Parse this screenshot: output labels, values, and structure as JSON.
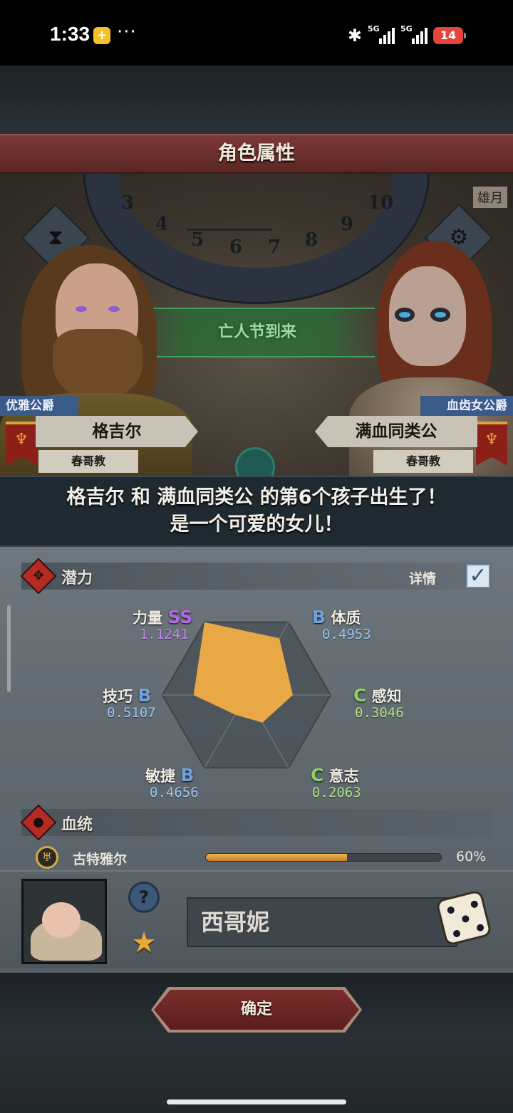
{
  "status_bar": {
    "time": "1:33",
    "app_icon_glyph": "+",
    "more": "···",
    "bluetooth_icon": "bluetooth-icon",
    "signal1_gen": "5G",
    "signal2_gen": "5G",
    "battery": "14"
  },
  "header": {
    "title": "角色属性"
  },
  "scene": {
    "event": "亡人节到来",
    "month_tag": "雄月",
    "ring_numbers": [
      "3",
      "4",
      "5",
      "6",
      "7",
      "8",
      "9",
      "10"
    ],
    "father": {
      "title": "优雅公爵",
      "name": "格吉尔",
      "religion": "春哥教"
    },
    "mother": {
      "title": "血齿女公爵",
      "name": "满血同类公",
      "religion": "春哥教"
    }
  },
  "message": {
    "line1": "格吉尔 和 满血同类公 的第6个孩子出生了！",
    "line2": "是一个可爱的女儿！"
  },
  "potential": {
    "section_title": "潜力",
    "detail_label": "详情",
    "detail_checked": true,
    "stats": [
      {
        "key": "strength",
        "label": "力量",
        "grade": "SS",
        "value": "1.1241",
        "level": 1.0
      },
      {
        "key": "constitution",
        "label": "体质",
        "grade": "B",
        "value": "0.4953",
        "level": 0.78
      },
      {
        "key": "perception",
        "label": "感知",
        "grade": "C",
        "value": "0.3046",
        "level": 0.55
      },
      {
        "key": "willpower",
        "label": "意志",
        "grade": "C",
        "value": "0.2063",
        "level": 0.38
      },
      {
        "key": "agility",
        "label": "敏捷",
        "grade": "B",
        "value": "0.4656",
        "level": 0.27
      },
      {
        "key": "skill",
        "label": "技巧",
        "grade": "B",
        "value": "0.5107",
        "level": 0.63
      }
    ]
  },
  "bloodline": {
    "section_title": "血统",
    "name": "古特雅尔",
    "percent_label": "60%",
    "percent": 0.6
  },
  "child": {
    "name": "西哥妮"
  },
  "footer": {
    "confirm_label": "确定"
  },
  "colors": {
    "radar_fill": "#e8a846",
    "title_banner": "#6a2f2b",
    "event_green": "#3fa05a"
  }
}
